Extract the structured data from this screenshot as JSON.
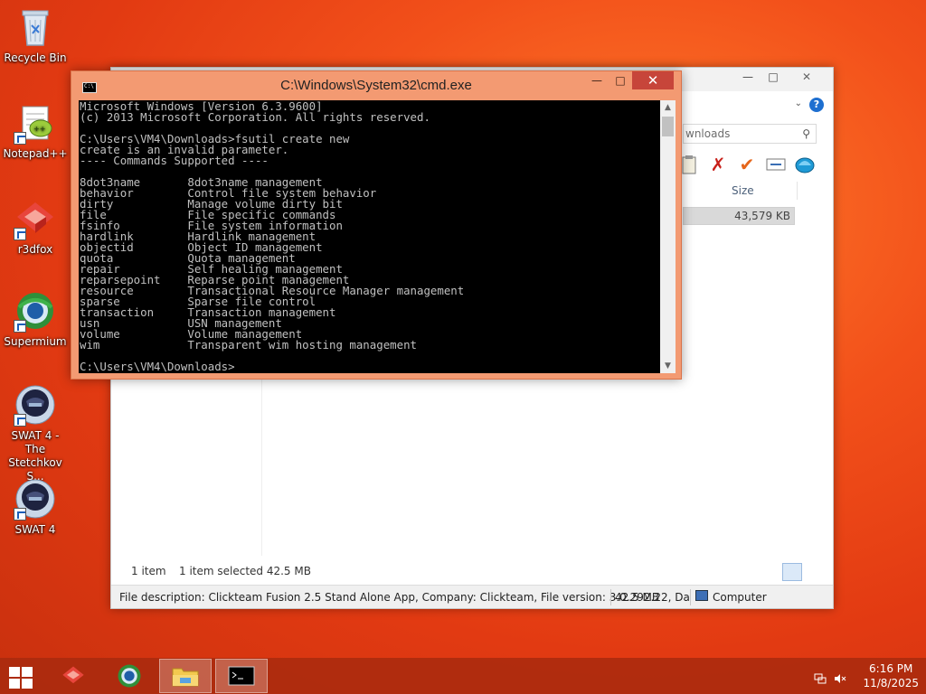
{
  "desktop": {
    "icons": [
      {
        "label": "Recycle Bin"
      },
      {
        "label": "Notepad++"
      },
      {
        "label": "r3dfox"
      },
      {
        "label": "Supermium"
      },
      {
        "label": "SWAT 4 - The Stetchkov S..."
      },
      {
        "label": "SWAT 4"
      }
    ]
  },
  "explorer": {
    "search_text": "wnloads",
    "column_size": "Size",
    "selected_size": "43,579 KB",
    "status": {
      "items": "1 item",
      "selected": "1 item selected  42.5 MB"
    },
    "description": "File description: Clickteam Fusion 2.5 Stand Alone App, Company: Clickteam, File version: 3.0.292.22, Da",
    "desc_size": "42.5 MB",
    "desc_location": "Computer"
  },
  "cmd": {
    "title": "C:\\Windows\\System32\\cmd.exe",
    "output": "Microsoft Windows [Version 6.3.9600]\n(c) 2013 Microsoft Corporation. All rights reserved.\n\nC:\\Users\\VM4\\Downloads>fsutil create new\ncreate is an invalid parameter.\n---- Commands Supported ----\n\n8dot3name       8dot3name management\nbehavior        Control file system behavior\ndirty           Manage volume dirty bit\nfile            File specific commands\nfsinfo          File system information\nhardlink        Hardlink management\nobjectid        Object ID management\nquota           Quota management\nrepair          Self healing management\nreparsepoint    Reparse point management\nresource        Transactional Resource Manager management\nsparse          Sparse file control\ntransaction     Transaction management\nusn             USN management\nvolume          Volume management\nwim             Transparent wim hosting management\n\nC:\\Users\\VM4\\Downloads>"
  },
  "taskbar": {
    "clock_time": "6:16 PM",
    "clock_date": "11/8/2025"
  },
  "colors": {
    "cmd_frame": "#f39a72",
    "cmd_close": "#c7453a",
    "taskbar": "#a82a0e"
  }
}
